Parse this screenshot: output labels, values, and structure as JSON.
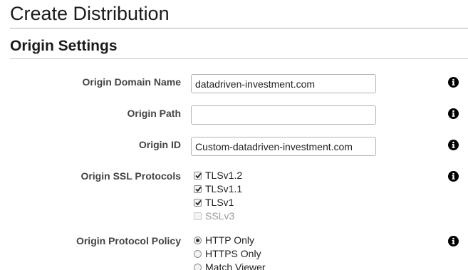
{
  "page": {
    "title": "Create Distribution"
  },
  "section": {
    "title": "Origin Settings"
  },
  "fields": {
    "origin_domain_name": {
      "label": "Origin Domain Name",
      "value": "datadriven-investment.com"
    },
    "origin_path": {
      "label": "Origin Path",
      "value": ""
    },
    "origin_id": {
      "label": "Origin ID",
      "value": "Custom-datadriven-investment.com"
    },
    "origin_ssl_protocols": {
      "label": "Origin SSL Protocols",
      "options": [
        {
          "label": "TLSv1.2",
          "checked": true,
          "disabled": false
        },
        {
          "label": "TLSv1.1",
          "checked": true,
          "disabled": false
        },
        {
          "label": "TLSv1",
          "checked": true,
          "disabled": false
        },
        {
          "label": "SSLv3",
          "checked": false,
          "disabled": true
        }
      ]
    },
    "origin_protocol_policy": {
      "label": "Origin Protocol Policy",
      "options": [
        {
          "label": "HTTP Only",
          "selected": true
        },
        {
          "label": "HTTPS Only",
          "selected": false
        },
        {
          "label": "Match Viewer",
          "selected": false
        }
      ]
    }
  },
  "icons": {
    "info": "info-circle-icon"
  }
}
